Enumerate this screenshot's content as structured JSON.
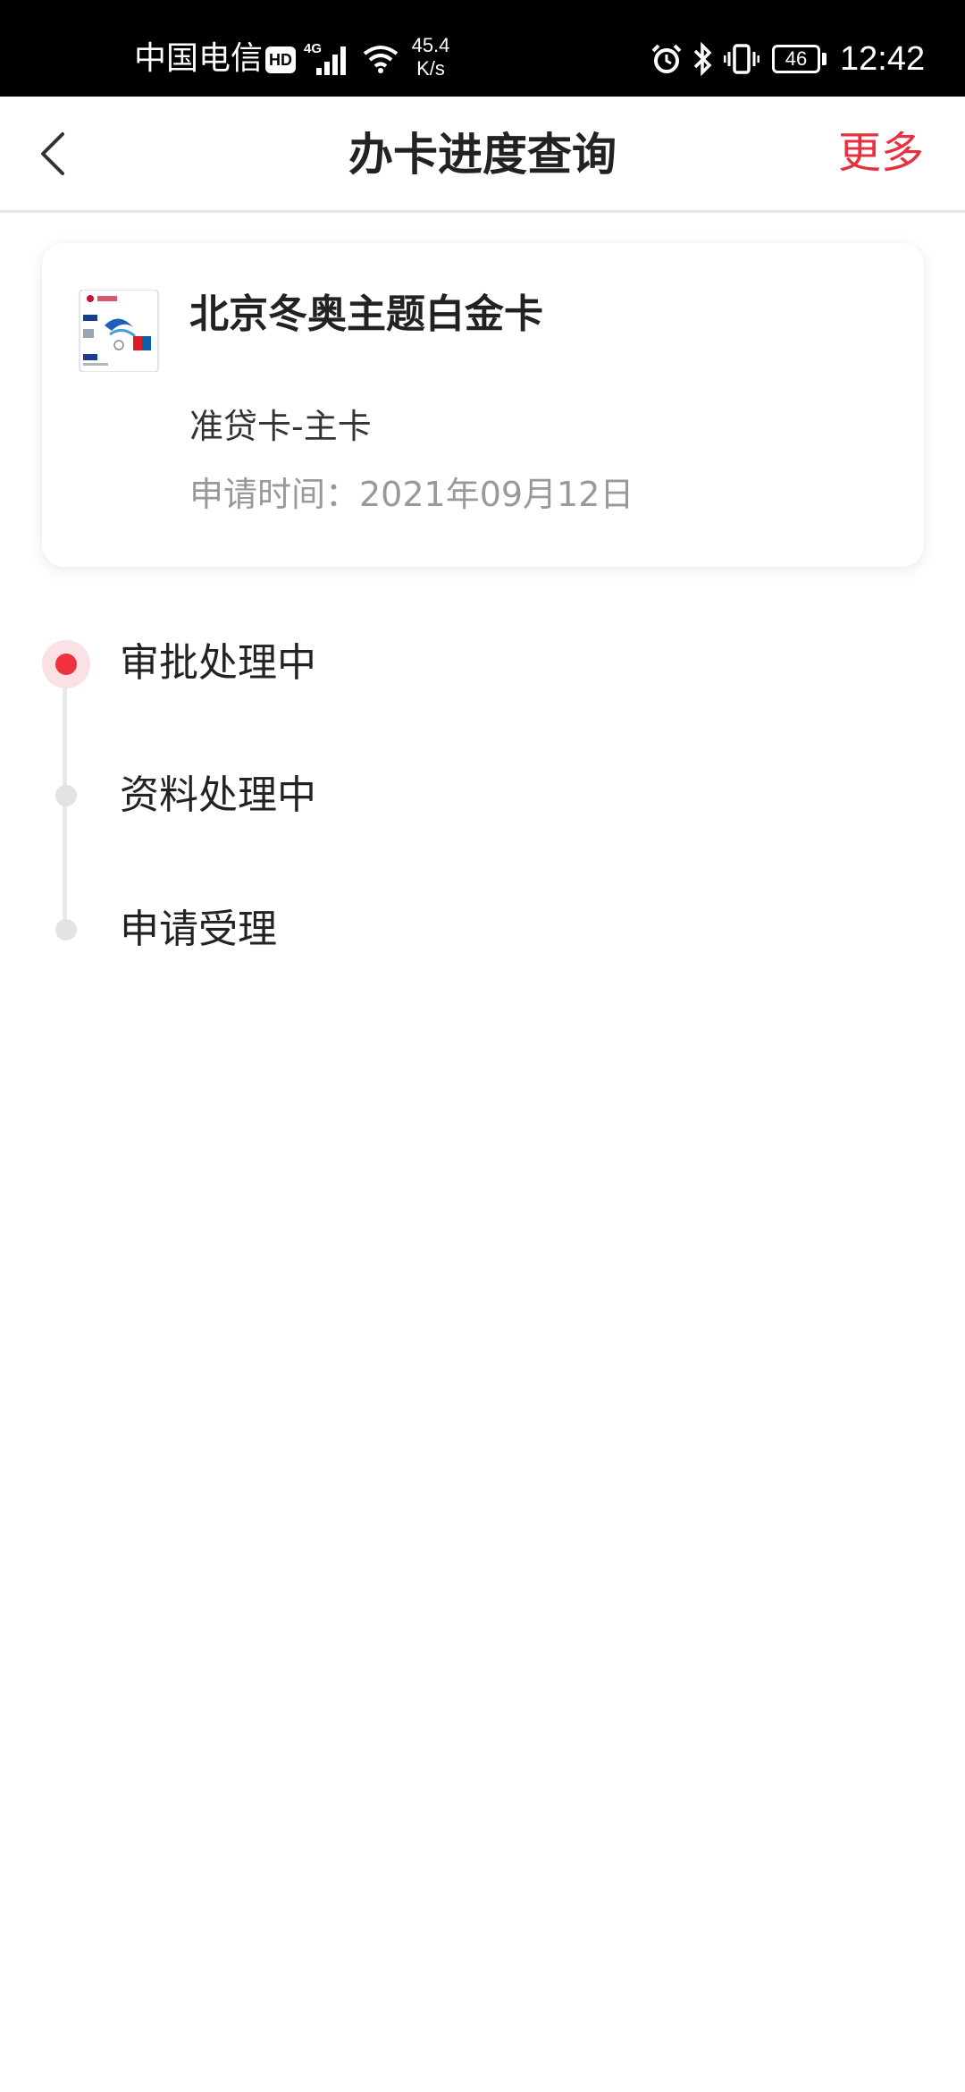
{
  "status_bar": {
    "carrier": "中国电信",
    "hd_badge": "HD",
    "network": "4G",
    "speed_value": "45.4",
    "speed_unit": "K/s",
    "battery": "46",
    "time": "12:42",
    "icons": [
      "signal-icon",
      "wifi-icon",
      "alarm-icon",
      "bluetooth-icon",
      "vibrate-icon",
      "battery-icon"
    ]
  },
  "header": {
    "back_icon": "chevron-left-icon",
    "title": "办卡进度查询",
    "more_label": "更多",
    "accent_color": "#e6303e"
  },
  "card": {
    "name": "北京冬奥主题白金卡",
    "type": "准贷卡-主卡",
    "date": "申请时间：2021年09月12日",
    "image": "credit-card-thumbnail"
  },
  "timeline": {
    "active_color": "#f0323f",
    "steps": [
      {
        "label": "审批处理中",
        "active": true
      },
      {
        "label": "资料处理中",
        "active": false
      },
      {
        "label": "申请受理",
        "active": false
      }
    ]
  }
}
